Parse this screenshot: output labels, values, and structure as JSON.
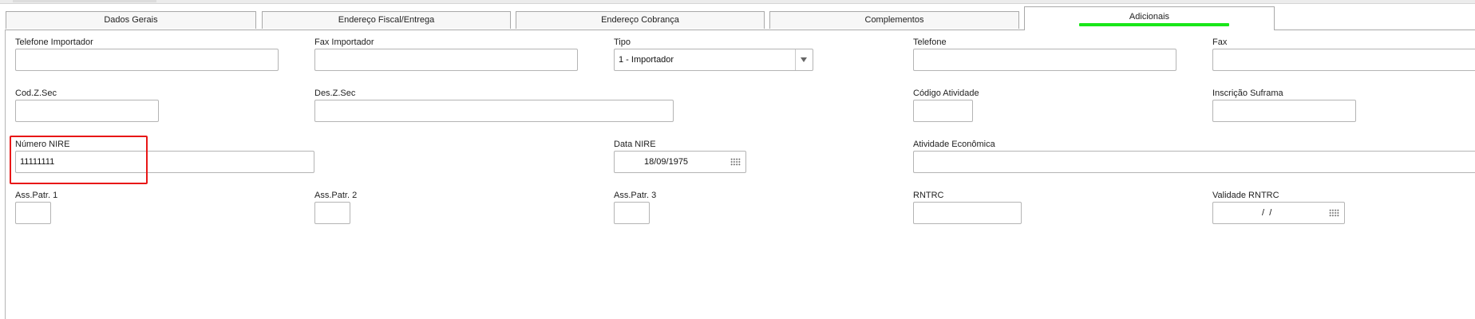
{
  "tabs": [
    {
      "label": "Dados Gerais"
    },
    {
      "label": "Endereço Fiscal/Entrega"
    },
    {
      "label": "Endereço Cobrança"
    },
    {
      "label": "Complementos"
    },
    {
      "label": "Adicionais"
    }
  ],
  "active_tab": "Adicionais",
  "highlight_color": "#e81717",
  "active_tab_marker_color": "#19e619",
  "fields": {
    "telefone_importador": {
      "label": "Telefone Importador",
      "value": ""
    },
    "fax_importador": {
      "label": "Fax Importador",
      "value": ""
    },
    "tipo": {
      "label": "Tipo",
      "value": "1 - Importador"
    },
    "telefone": {
      "label": "Telefone",
      "value": ""
    },
    "fax": {
      "label": "Fax",
      "value": ""
    },
    "cod_z_sec": {
      "label": "Cod.Z.Sec",
      "value": ""
    },
    "des_z_sec": {
      "label": "Des.Z.Sec",
      "value": ""
    },
    "codigo_atividade": {
      "label": "Código Atividade",
      "value": ""
    },
    "inscricao_suframa": {
      "label": "Inscrição Suframa",
      "value": ""
    },
    "numero_nire": {
      "label": "Número NIRE",
      "value": "11111111"
    },
    "data_nire": {
      "label": "Data NIRE",
      "value": "18/09/1975"
    },
    "atividade_economica": {
      "label": "Atividade Econômica",
      "value": ""
    },
    "ass_patr_1": {
      "label": "Ass.Patr. 1",
      "value": ""
    },
    "ass_patr_2": {
      "label": "Ass.Patr. 2",
      "value": ""
    },
    "ass_patr_3": {
      "label": "Ass.Patr. 3",
      "value": ""
    },
    "rntrc": {
      "label": "RNTRC",
      "value": ""
    },
    "validade_rntrc": {
      "label": "Validade RNTRC",
      "value": " /  /"
    }
  }
}
